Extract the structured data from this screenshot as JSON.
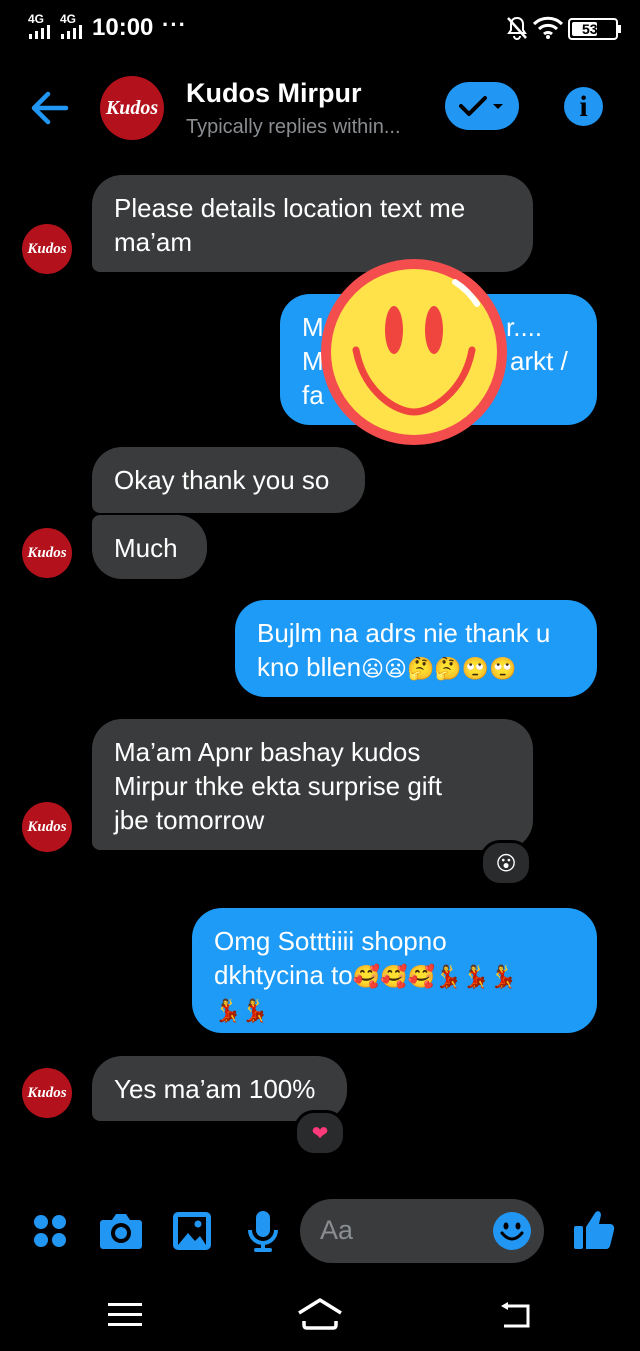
{
  "status_bar": {
    "network1": "4G",
    "network2": "4G",
    "time": "10:00",
    "more": "···",
    "battery": "53"
  },
  "header": {
    "contact_name": "Kudos Mirpur",
    "subtitle": "Typically replies within...",
    "logo_text": "Kudos",
    "accent_color": "#2196f3"
  },
  "messages": [
    {
      "side": "in",
      "text_lines": [
        "Please details location text me",
        "ma’am"
      ]
    },
    {
      "side": "out",
      "text_lines": [
        "M",
        "M",
        "fa",
        "r....",
        "arkt /"
      ]
    },
    {
      "side": "in",
      "text_lines": [
        "Okay thank you so"
      ]
    },
    {
      "side": "in",
      "text_lines": [
        "Much"
      ]
    },
    {
      "side": "out",
      "text_lines": [
        "Bujlm na adrs nie thank u",
        "kno bllen"
      ],
      "emojis": "😦😦🤔🤔🙄🙄"
    },
    {
      "side": "in",
      "text_lines": [
        "Ma’am Apnr bashay kudos",
        "Mirpur thke ekta surprise gift",
        "jbe tomorrow"
      ],
      "reaction": "😮"
    },
    {
      "side": "out",
      "text_lines": [
        "Omg Sotttiiii shopno",
        "dkhtycina to"
      ],
      "emojis_inline": "🥰🥰🥰💃💃💃",
      "emojis_next": "💃💃"
    },
    {
      "side": "in",
      "text_lines": [
        "Yes ma’am 100%"
      ],
      "reaction": "❤"
    }
  ],
  "sticker": "smiley-face",
  "composer": {
    "placeholder": "Aa",
    "icons": [
      "apps-icon",
      "camera-icon",
      "gallery-icon",
      "microphone-icon",
      "emoji-icon",
      "thumbs-up-icon"
    ]
  },
  "nav_bar": {
    "icons": [
      "menu-icon",
      "home-icon",
      "back-icon"
    ]
  }
}
